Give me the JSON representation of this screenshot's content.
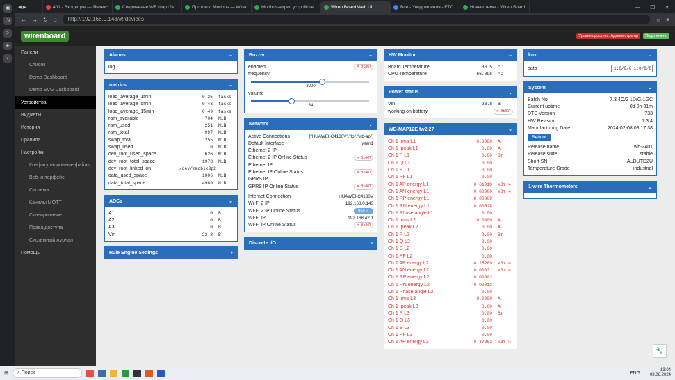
{
  "browser": {
    "tabs": [
      {
        "label": "401 - Входящие — Яндекс",
        "color": "#ea4335"
      },
      {
        "label": "Соединение WB map12e",
        "color": "#34a853"
      },
      {
        "label": "Протокол Modbus — Wiren",
        "color": "#34a853"
      },
      {
        "label": "Modbus-адрес устройств",
        "color": "#34a853"
      },
      {
        "label": "Wiren Board Web UI",
        "color": "#34a853"
      },
      {
        "label": "Все - Уведомления - ETC",
        "color": "#4285f4"
      },
      {
        "label": "Новые темы - Wiren Board",
        "color": "#34a853"
      }
    ],
    "url": "http://192.168.0.143/#!/devices"
  },
  "header": {
    "logo": "wirenboard",
    "access": "Уровень доступа: Администратор",
    "conn": "Подключено"
  },
  "sidebar": [
    {
      "label": "Панели",
      "sub": false,
      "active": false
    },
    {
      "label": "Список",
      "sub": true,
      "active": false
    },
    {
      "label": "Demo Dashboard",
      "sub": true,
      "active": false
    },
    {
      "label": "Demo SVG Dashboard",
      "sub": true,
      "active": false
    },
    {
      "label": "Устройства",
      "sub": false,
      "active": true
    },
    {
      "label": "Виджеты",
      "sub": false,
      "active": false
    },
    {
      "label": "История",
      "sub": false,
      "active": false
    },
    {
      "label": "Правила",
      "sub": false,
      "active": false
    },
    {
      "label": "Настройки",
      "sub": false,
      "active": false
    },
    {
      "label": "Конфигурационные файлы",
      "sub": true,
      "active": false
    },
    {
      "label": "Веб-интерфейс",
      "sub": true,
      "active": false
    },
    {
      "label": "Система",
      "sub": true,
      "active": false
    },
    {
      "label": "Каналы MQTT",
      "sub": true,
      "active": false
    },
    {
      "label": "Сканирование",
      "sub": true,
      "active": false
    },
    {
      "label": "Права доступа",
      "sub": true,
      "active": false
    },
    {
      "label": "Системный журнал",
      "sub": true,
      "active": false
    },
    {
      "label": "Помощь",
      "sub": false,
      "active": false
    }
  ],
  "alarms": {
    "title": "Alarms",
    "log": "log"
  },
  "metrics": {
    "title": "metrics",
    "rows": [
      [
        "load_average_1min",
        "0.35",
        "tasks"
      ],
      [
        "load_average_5min",
        "0.43",
        "tasks"
      ],
      [
        "load_average_15min",
        "0.49",
        "tasks"
      ],
      [
        "ram_available",
        "704",
        "MiB"
      ],
      [
        "ram_used",
        "251",
        "MiB"
      ],
      [
        "ram_total",
        "997",
        "MiB"
      ],
      [
        "swap_total",
        "255",
        "MiB"
      ],
      [
        "swap_used",
        "0",
        "MiB"
      ],
      [
        "dev_root_used_space",
        "626",
        "MiB"
      ],
      [
        "dev_root_total_space",
        "1978",
        "MiB"
      ],
      [
        "dev_root_linked_on",
        "/dev/mmcblk0p2",
        ""
      ],
      [
        "data_used_space",
        "1006",
        "MiB"
      ],
      [
        "data_total_space",
        "4969",
        "MiB"
      ]
    ]
  },
  "adcs": {
    "title": "ADCs",
    "rows": [
      [
        "A1",
        "0",
        "B"
      ],
      [
        "A2",
        "0",
        "B"
      ],
      [
        "A3",
        "0",
        "B"
      ],
      [
        "Vin",
        "23.8",
        "B"
      ]
    ]
  },
  "rules": {
    "title": "Rule Engine Settings"
  },
  "buzzer": {
    "title": "Buzzer",
    "enabled": "enabled",
    "off": "ВЫКЛ",
    "frequency": "frequency",
    "freq_val": "3000",
    "freq_level": 0.6,
    "volume": "volume",
    "vol_val": "34",
    "vol_level": 0.34
  },
  "network": {
    "title": "Network",
    "rows": [
      [
        "Active Connections",
        "[\"HUAWEI-C4130V\",\"lo\",\"wb-ap\"]"
      ],
      [
        "Default Interface",
        "wlan1"
      ],
      [
        "Ethernet 2 IP",
        ""
      ],
      [
        "Ethernet 2 IP Online Status",
        "SW_OFF"
      ],
      [
        "Ethernet IP",
        ""
      ],
      [
        "Ethernet IP Online Status",
        "SW_OFF"
      ],
      [
        "GPRS IP",
        ""
      ],
      [
        "GPRS IP Online Status",
        "SW_OFF"
      ],
      [
        "Internet Connection",
        "HUAWEI-C4130V"
      ],
      [
        "Wi-Fi 2 IP",
        "192.168.0.143"
      ],
      [
        "Wi-Fi 2 IP Online Status",
        "SW_ON"
      ],
      [
        "Wi-Fi IP",
        "192.168.42.1"
      ],
      [
        "Wi-Fi IP Online Status",
        "SW_OFF"
      ]
    ],
    "on": "ВКЛ",
    "off": "ВЫКЛ"
  },
  "discrete": {
    "title": "Discrete I/O"
  },
  "hw": {
    "title": "HW Monitor",
    "rows": [
      [
        "Board Temperature",
        "36.5",
        "°C"
      ],
      [
        "CPU Temperature",
        "66.896",
        "°C"
      ]
    ]
  },
  "power": {
    "title": "Power status",
    "vin": "Vin",
    "vin_val": "23.8",
    "vin_u": "B",
    "battery": "working on battery",
    "off": "ВЫКЛ"
  },
  "map": {
    "title": "WB-MAP12E fw2 27",
    "rows": [
      [
        "Ch 1 Irms L1",
        "0.0000",
        "A"
      ],
      [
        "Ch 1 Ipeak L1",
        "0.00",
        "A"
      ],
      [
        "Ch 1 P L1",
        "0.00",
        "Вт"
      ],
      [
        "Ch 1 Q L1",
        "0.00",
        ""
      ],
      [
        "Ch 1 S L1",
        "0.00",
        ""
      ],
      [
        "Ch 1 PF L1",
        "0.00",
        ""
      ],
      [
        "Ch 1 AP energy L1",
        "0.61018",
        "кВт·ч"
      ],
      [
        "Ch 1 AN energy L1",
        "0.00000",
        "кВт·ч"
      ],
      [
        "Ch 1 RP energy L1",
        "0.00009",
        ""
      ],
      [
        "Ch 1 RN energy L1",
        "0.00528",
        ""
      ],
      [
        "Ch 1 Phase angle L1",
        "0.00",
        ""
      ],
      [
        "Ch 1 Irms L2",
        "0.0000",
        "A"
      ],
      [
        "Ch 1 Ipeak L2",
        "0.00",
        "A"
      ],
      [
        "Ch 1 P L2",
        "0.00",
        "Вт"
      ],
      [
        "Ch 1 Q L2",
        "0.00",
        ""
      ],
      [
        "Ch 1 S L2",
        "0.00",
        ""
      ],
      [
        "Ch 1 PF L2",
        "0.00",
        ""
      ],
      [
        "Ch 1 AP energy L2",
        "0.25289",
        "кВт·ч"
      ],
      [
        "Ch 1 AN energy L2",
        "0.00031",
        "кВт·ч"
      ],
      [
        "Ch 1 RP energy L2",
        "0.00002",
        ""
      ],
      [
        "Ch 1 RN energy L2",
        "0.00012",
        ""
      ],
      [
        "Ch 1 Phase angle L2",
        "0.00",
        ""
      ],
      [
        "Ch 1 Irms L3",
        "0.0000",
        "A"
      ],
      [
        "Ch 1 Ipeak L3",
        "0.00",
        "A"
      ],
      [
        "Ch 1 P L3",
        "0.00",
        "Вт"
      ],
      [
        "Ch 1 Q L3",
        "0.00",
        ""
      ],
      [
        "Ch 1 S L3",
        "0.00",
        ""
      ],
      [
        "Ch 1 PF L3",
        "0.00",
        ""
      ],
      [
        "Ch 1 AP energy L3",
        "0.37863",
        "кВт·ч"
      ]
    ]
  },
  "knx": {
    "title": "knx",
    "data": "data",
    "value": "1:0/0/0 1:0/0/0"
  },
  "system": {
    "title": "System",
    "rows": [
      [
        "Batch No",
        "7.3.4O/2 1D/G-1GC"
      ],
      [
        "Current uptime",
        "0d 0h 31m"
      ],
      [
        "DTS Version",
        "733"
      ],
      [
        "HW Revision",
        "7.3.4"
      ],
      [
        "Manufacturing Date",
        "2024-02-08 08:17:38"
      ]
    ],
    "reboot": "Reboot",
    "rows2": [
      [
        "Release name",
        "wb-2401"
      ],
      [
        "Release suite",
        "stable"
      ],
      [
        "Short SN",
        "ALDUTD2U"
      ],
      [
        "Temperature Grade",
        "industrial"
      ]
    ]
  },
  "onewire": {
    "title": "1-wire Thermometers"
  },
  "taskbar": {
    "search": "Поиск",
    "lang": "ENG",
    "time": "13:04",
    "date": "03.06.2024"
  }
}
